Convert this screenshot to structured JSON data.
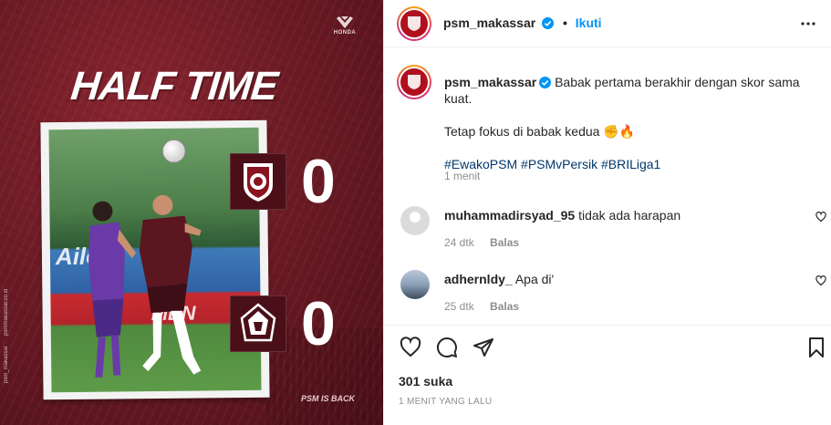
{
  "post": {
    "brand": {
      "sponsor": "HONDA",
      "headline": "HALF TIME",
      "watermark": "PSM IS BACK",
      "side_text": [
        "psm_makassar",
        "psmmakassar.co.id"
      ],
      "ads": [
        "Aile",
        "MEN"
      ],
      "teams": [
        {
          "score": "0"
        },
        {
          "score": "0"
        }
      ]
    },
    "colors": {
      "maroon": "#6d1b25",
      "link_blue": "#0095f6",
      "hashtag": "#00376b",
      "muted": "#8e8e8e"
    }
  },
  "header": {
    "username": "psm_makassar",
    "separator": "•",
    "follow_label": "Ikuti",
    "more_icon": "more-horizontal-icon"
  },
  "caption": {
    "username": "psm_makassar",
    "text": "Babak pertama berakhir dengan skor sama kuat.",
    "line2": "Tetap fokus di babak kedua",
    "emojis": "✊🔥",
    "hashtags": [
      "#EwakoPSM",
      "#PSMvPersik",
      "#BRILiga1"
    ],
    "time": "1 menit"
  },
  "comments": [
    {
      "username": "muhammadirsyad_95",
      "text": "tidak ada harapan",
      "time": "24 dtk",
      "reply": "Balas"
    },
    {
      "username": "adhernldy_",
      "text": "Apa di'",
      "time": "25 dtk",
      "reply": "Balas"
    }
  ],
  "footer": {
    "likes": "301 suka",
    "time_ago": "1 MENIT YANG LALU"
  }
}
